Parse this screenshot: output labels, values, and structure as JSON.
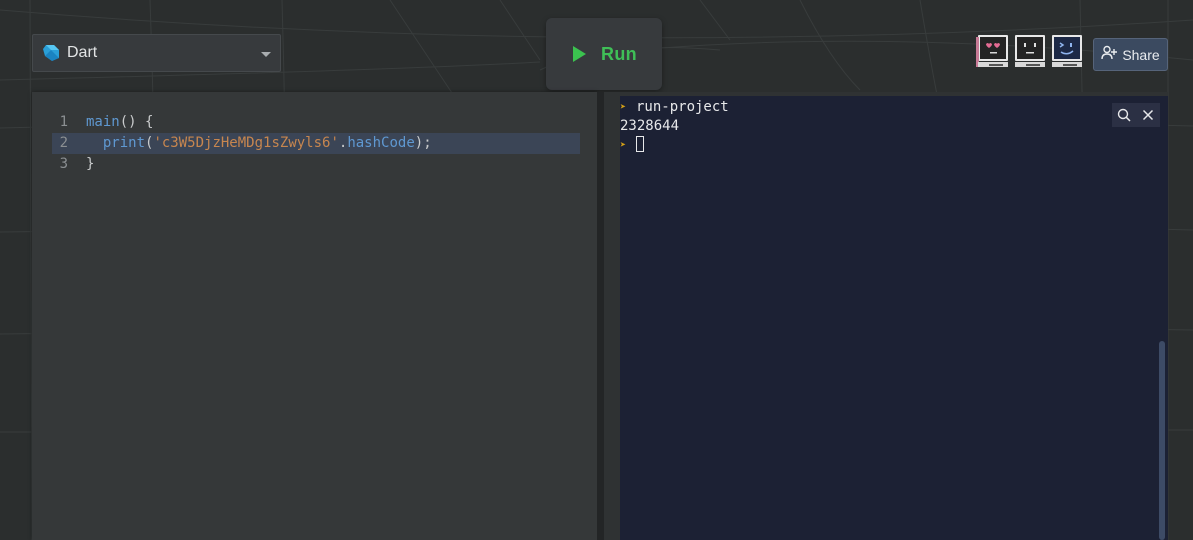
{
  "colors": {
    "background": "#2b2e2e",
    "panel": "#353839",
    "terminal": "#1c2134",
    "run_green": "#3fbf57",
    "share_bg": "#3b4a60",
    "prompt_yellow": "#d4a017"
  },
  "language_selector": {
    "icon": "dart-logo-icon",
    "label": "Dart"
  },
  "run_button": {
    "icon": "play-icon",
    "label": "Run"
  },
  "avatars": [
    {
      "name": "heart-eyes-computer-avatar",
      "screen": "#2a2a2a",
      "accent": "#e05a8a"
    },
    {
      "name": "neutral-computer-avatar",
      "screen": "#2a2a2a",
      "accent": "#d8d8d8"
    },
    {
      "name": "smirk-computer-avatar",
      "screen": "#1d2a44",
      "accent": "#7fa8e8"
    }
  ],
  "share_button": {
    "icon": "add-user-icon",
    "label": "Share"
  },
  "editor": {
    "lines": [
      {
        "num": "1",
        "tokens": [
          {
            "t": "main",
            "k": "fn"
          },
          {
            "t": "() {",
            "k": "punct"
          }
        ]
      },
      {
        "num": "2",
        "active": true,
        "tokens": [
          {
            "t": "  ",
            "k": "punct"
          },
          {
            "t": "print",
            "k": "fn"
          },
          {
            "t": "(",
            "k": "punct"
          },
          {
            "t": "'c3W5DjzHeMDg1sZwyls6'",
            "k": "str"
          },
          {
            "t": ".",
            "k": "punct"
          },
          {
            "t": "hashCode",
            "k": "fn"
          },
          {
            "t": ");",
            "k": "punct"
          }
        ]
      },
      {
        "num": "3",
        "tokens": [
          {
            "t": "}",
            "k": "punct"
          }
        ]
      }
    ]
  },
  "terminal": {
    "lines": [
      {
        "prompt": true,
        "text": "run-project"
      },
      {
        "prompt": false,
        "text": "2328644"
      },
      {
        "prompt": true,
        "text": "",
        "cursor": true
      }
    ],
    "tools": [
      {
        "name": "terminal-search-icon",
        "glyph": "search"
      },
      {
        "name": "terminal-close-icon",
        "glyph": "close"
      }
    ]
  }
}
